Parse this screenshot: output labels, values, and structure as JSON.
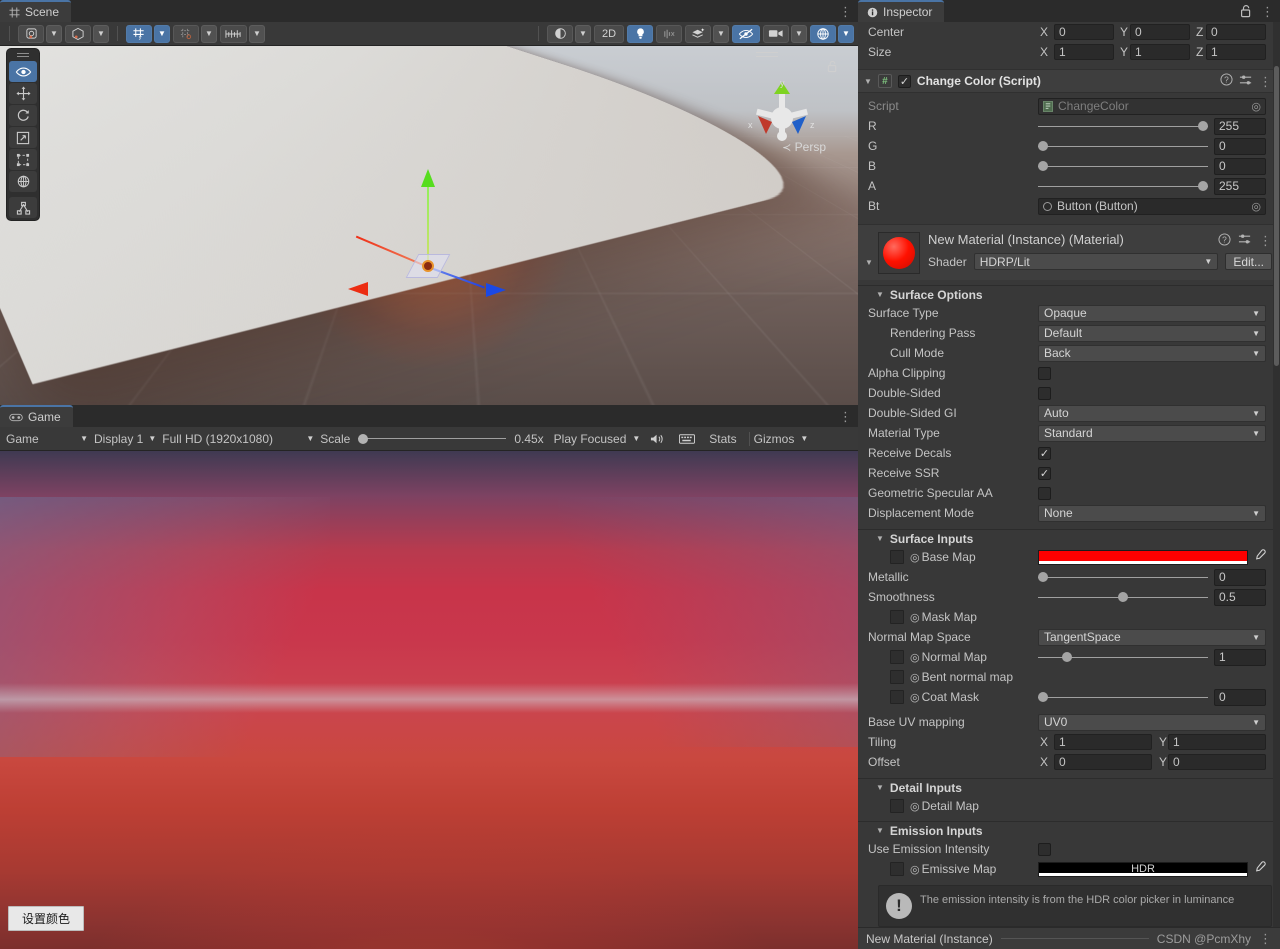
{
  "scene": {
    "tab_label": "Scene",
    "tab_icon": "grid-icon",
    "toolbar": {
      "view_tool": "view-options-icon",
      "pivot_tool": "pivot-rotation-icon",
      "grid_snap": "grid-snap-icon",
      "snap_increment": "snap-increment-icon",
      "grid_visibility": "grid-visibility-icon",
      "shading_mode": "shading-mode-icon",
      "two_d_label": "2D",
      "lighting": "lighting-icon",
      "audio": "audio-mute-icon",
      "effects": "fx-icon",
      "hidden_objects": "hidden-objects-icon",
      "camera": "scene-camera-icon",
      "gizmos": "gizmos-icon"
    },
    "tools": [
      {
        "name": "view-tool",
        "glyph": "eye"
      },
      {
        "name": "move-tool",
        "glyph": "move"
      },
      {
        "name": "rotate-tool",
        "glyph": "rotate"
      },
      {
        "name": "scale-tool",
        "glyph": "scale"
      },
      {
        "name": "rect-tool",
        "glyph": "rect"
      },
      {
        "name": "transform-tool",
        "glyph": "transform"
      },
      {
        "name": "custom-tool",
        "glyph": "custom"
      }
    ],
    "gizmo": {
      "x_label": "x",
      "y_label": "y",
      "z_label": "z",
      "projection": "Persp"
    }
  },
  "game": {
    "tab_label": "Game",
    "tab_icon": "gamepad-icon",
    "toolbar": {
      "aspect_mode": "Game",
      "display": "Display 1",
      "resolution": "Full HD (1920x1080)",
      "scale_label": "Scale",
      "scale_value": "0.45x",
      "play_mode": "Play Focused",
      "mute_audio_icon": "speaker-icon",
      "keyboard_icon": "keyboard-icon",
      "stats_label": "Stats",
      "gizmos_label": "Gizmos"
    },
    "set_color_button": "设置颜色"
  },
  "inspector": {
    "tab_label": "Inspector",
    "tab_icon": "info-icon",
    "lock_icon": "lock-open-icon",
    "menu_icon": "kebab-menu-icon",
    "collider": {
      "center_label": "Center",
      "center": {
        "x_label": "X",
        "x": "0",
        "y_label": "Y",
        "y": "0",
        "z_label": "Z",
        "z": "0"
      },
      "size_label": "Size",
      "size": {
        "x_label": "X",
        "x": "1",
        "y_label": "Y",
        "y": "1",
        "z_label": "Z",
        "z": "1"
      }
    },
    "change_color": {
      "title": "Change Color (Script)",
      "enabled": true,
      "script_label": "Script",
      "script_value": "ChangeColor",
      "help_icon": "help-icon",
      "preset_icon": "preset-icon",
      "menu_icon": "kebab-menu-icon",
      "fields": [
        {
          "label": "R",
          "value": "255",
          "slider_pct": 100
        },
        {
          "label": "G",
          "value": "0",
          "slider_pct": 0
        },
        {
          "label": "B",
          "value": "0",
          "slider_pct": 0
        },
        {
          "label": "A",
          "value": "255",
          "slider_pct": 100
        }
      ],
      "bt_label": "Bt",
      "bt_value": "Button (Button)"
    },
    "material": {
      "title": "New Material (Instance) (Material)",
      "preview_color": "#ff1100",
      "shader_label": "Shader",
      "shader_value": "HDRP/Lit",
      "edit_label": "Edit...",
      "help_icon": "help-icon",
      "preset_icon": "preset-icon",
      "menu_icon": "kebab-menu-icon"
    },
    "surface_options": {
      "header": "Surface Options",
      "rows": [
        {
          "label": "Surface Type",
          "type": "dropdown",
          "value": "Opaque",
          "indent": false
        },
        {
          "label": "Rendering Pass",
          "type": "dropdown",
          "value": "Default",
          "indent": true
        },
        {
          "label": "Cull Mode",
          "type": "dropdown",
          "value": "Back",
          "indent": true
        },
        {
          "label": "Alpha Clipping",
          "type": "checkbox",
          "checked": false,
          "indent": false
        },
        {
          "label": "Double-Sided",
          "type": "checkbox",
          "checked": false,
          "indent": false
        },
        {
          "label": "Double-Sided GI",
          "type": "dropdown",
          "value": "Auto",
          "indent": false
        },
        {
          "label": "Material Type",
          "type": "dropdown",
          "value": "Standard",
          "indent": false
        },
        {
          "label": "Receive Decals",
          "type": "checkbox",
          "checked": true,
          "indent": false
        },
        {
          "label": "Receive SSR",
          "type": "checkbox",
          "checked": true,
          "indent": false
        },
        {
          "label": "Geometric Specular AA",
          "type": "checkbox",
          "checked": false,
          "indent": false
        },
        {
          "label": "Displacement Mode",
          "type": "dropdown",
          "value": "None",
          "indent": false
        }
      ]
    },
    "surface_inputs": {
      "header": "Surface Inputs",
      "base_map_label": "Base Map",
      "base_map_color": "#ff0000",
      "metallic_label": "Metallic",
      "metallic_value": "0",
      "metallic_pct": 0,
      "smoothness_label": "Smoothness",
      "smoothness_value": "0.5",
      "smoothness_pct": 50,
      "mask_map_label": "Mask Map",
      "normal_map_space_label": "Normal Map Space",
      "normal_map_space_value": "TangentSpace",
      "normal_map_label": "Normal Map",
      "normal_map_value": "1",
      "normal_map_pct": 15,
      "bent_normal_map_label": "Bent normal map",
      "coat_mask_label": "Coat Mask",
      "coat_mask_value": "0",
      "coat_mask_pct": 0,
      "base_uv_label": "Base UV mapping",
      "base_uv_value": "UV0",
      "tiling_label": "Tiling",
      "tiling": {
        "x_label": "X",
        "x": "1",
        "y_label": "Y",
        "y": "1"
      },
      "offset_label": "Offset",
      "offset": {
        "x_label": "X",
        "x": "0",
        "y_label": "Y",
        "y": "0"
      }
    },
    "detail_inputs": {
      "header": "Detail Inputs",
      "detail_map_label": "Detail Map"
    },
    "emission_inputs": {
      "header": "Emission Inputs",
      "use_emission_intensity_label": "Use Emission Intensity",
      "use_emission_intensity_checked": false,
      "emissive_map_label": "Emissive Map",
      "emissive_hdr_label": "HDR",
      "info_text": "The emission intensity is from the HDR color picker in luminance"
    },
    "footer": {
      "name": "New Material (Instance)",
      "watermark": "CSDN @PcmXhy",
      "menu_icon": "kebab-menu-icon"
    }
  }
}
